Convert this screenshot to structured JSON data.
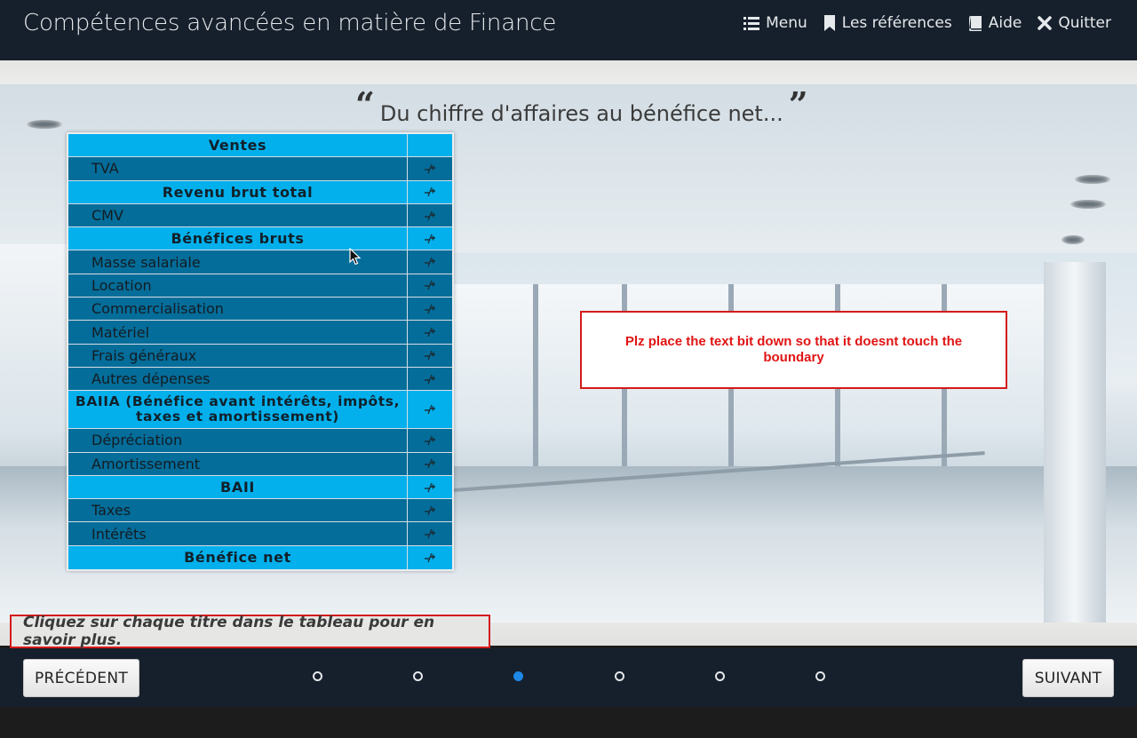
{
  "header": {
    "title": "Compétences avancées en matière de Finance",
    "nav": [
      {
        "icon": "list-icon",
        "label": "Menu"
      },
      {
        "icon": "bookmark-icon",
        "label": "Les références"
      },
      {
        "icon": "book-icon",
        "label": "Aide"
      },
      {
        "icon": "close-icon",
        "label": "Quitter"
      }
    ]
  },
  "quote": {
    "open": "“",
    "text": "Du chiffre d'affaires au bénéfice net...",
    "close": "”"
  },
  "table": {
    "rows": [
      {
        "label": "Ventes",
        "type": "head",
        "sign": ""
      },
      {
        "label": "TVA",
        "type": "sub",
        "sign": "-/+"
      },
      {
        "label": "Revenu brut total",
        "type": "head",
        "sign": "-/+"
      },
      {
        "label": "CMV",
        "type": "sub",
        "sign": "-/+"
      },
      {
        "label": "Bénéfices bruts",
        "type": "head",
        "sign": "-/+"
      },
      {
        "label": "Masse salariale",
        "type": "sub",
        "sign": "-/+"
      },
      {
        "label": "Location",
        "type": "sub",
        "sign": "-/+"
      },
      {
        "label": "Commercialisation",
        "type": "sub",
        "sign": "-/+"
      },
      {
        "label": "Matériel",
        "type": "sub",
        "sign": "-/+"
      },
      {
        "label": "Frais généraux",
        "type": "sub",
        "sign": "-/+"
      },
      {
        "label": "Autres dépenses",
        "type": "sub",
        "sign": "-/+"
      },
      {
        "label": "BAIIA (Bénéfice avant intérêts, impôts, taxes et amortissement)",
        "type": "head tall",
        "sign": "-/+"
      },
      {
        "label": "Dépréciation",
        "type": "sub",
        "sign": "-/+"
      },
      {
        "label": "Amortissement",
        "type": "sub",
        "sign": "-/+"
      },
      {
        "label": "BAII",
        "type": "head",
        "sign": "-/+"
      },
      {
        "label": "Taxes",
        "type": "sub",
        "sign": "-/+"
      },
      {
        "label": "Intérêts",
        "type": "sub",
        "sign": "-/+"
      },
      {
        "label": "Bénéfice net",
        "type": "head",
        "sign": "-/+"
      }
    ]
  },
  "note": {
    "text": "Plz place the text bit down so that it doesnt touch the boundary"
  },
  "instruction": {
    "text": "Cliquez sur chaque titre dans le tableau pour en savoir plus."
  },
  "footer": {
    "prev_label": "PRÉCÉDENT",
    "next_label": "SUIVANT",
    "dots_count": 6,
    "active_dot": 2
  },
  "colors": {
    "header_bg": "#16202c",
    "table_head": "#03b0ec",
    "table_sub": "#046d9a",
    "note_border": "#d41a1a",
    "active_dot": "#1e88e5"
  }
}
